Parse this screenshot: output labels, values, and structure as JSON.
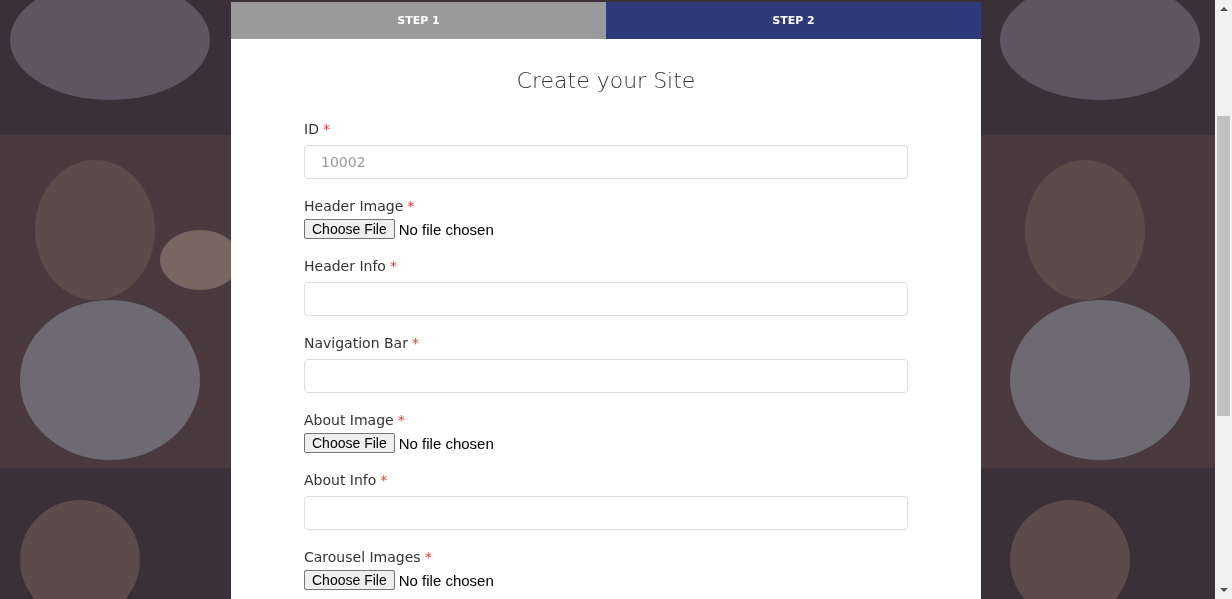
{
  "steps": [
    {
      "label": "STEP 1",
      "selected": false
    },
    {
      "label": "STEP 2",
      "selected": true
    }
  ],
  "title": "Create your Site",
  "fields": [
    {
      "kind": "text",
      "label": "ID",
      "mark": "*",
      "placeholder": "10002"
    },
    {
      "kind": "file",
      "label": "Header Image",
      "mark": "*",
      "button": "Choose File",
      "status": "No file chosen"
    },
    {
      "kind": "text",
      "label": "Header Info",
      "mark": "*"
    },
    {
      "kind": "text",
      "label": "Navigation Bar",
      "mark": "*"
    },
    {
      "kind": "file",
      "label": "About Image",
      "mark": "*",
      "button": "Choose File",
      "status": "No file chosen"
    },
    {
      "kind": "text",
      "label": "About Info",
      "mark": "*"
    },
    {
      "kind": "file",
      "label": "Carousel Images",
      "mark": "*",
      "button": "Choose File",
      "status": "No file chosen"
    }
  ]
}
